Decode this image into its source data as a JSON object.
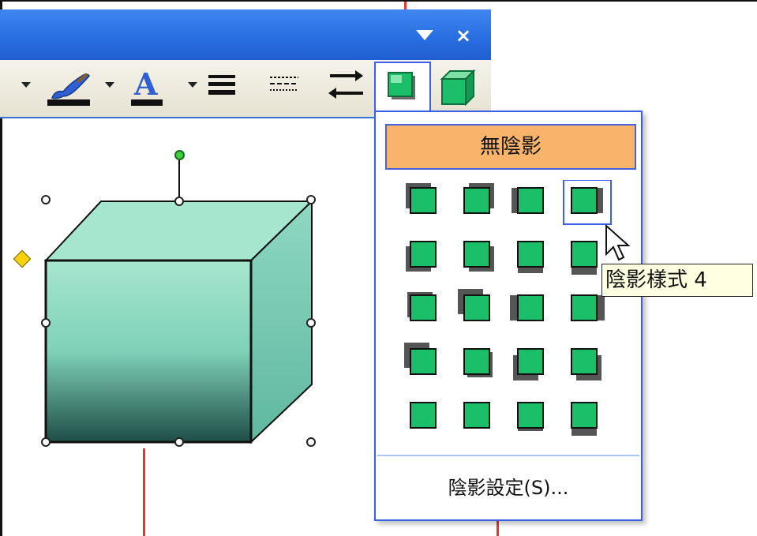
{
  "window": {
    "title_menu_icon": "dropdown-arrow-icon",
    "close_label": "×"
  },
  "toolbar": {
    "items": [
      {
        "name": "fill-color-dropdown",
        "icon": "dropdown-arrow-icon"
      },
      {
        "name": "line-color-button",
        "icon": "paintbrush-icon"
      },
      {
        "name": "font-color-button",
        "icon": "font-color-a-icon",
        "label": "A"
      },
      {
        "name": "line-style-button",
        "icon": "line-style-icon"
      },
      {
        "name": "dash-style-button",
        "icon": "dash-style-icon"
      },
      {
        "name": "arrow-style-button",
        "icon": "arrow-style-icon"
      },
      {
        "name": "shadow-style-button",
        "icon": "shadow-cube-icon",
        "active": true
      },
      {
        "name": "3d-style-button",
        "icon": "3d-cube-icon"
      }
    ]
  },
  "shadow_menu": {
    "no_shadow_label": "無陰影",
    "settings_label": "陰影設定(S)...",
    "tooltip": "陰影樣式 4",
    "selected_option": 4,
    "options_count": 20
  },
  "colors": {
    "accent_blue": "#2a6fe2",
    "swatch_green": "#1bbf6a",
    "highlight_orange": "#f8b46a",
    "callout_red": "#e5372b",
    "cube_front": "#7fd1b8",
    "cube_top": "#a6e6cf"
  }
}
